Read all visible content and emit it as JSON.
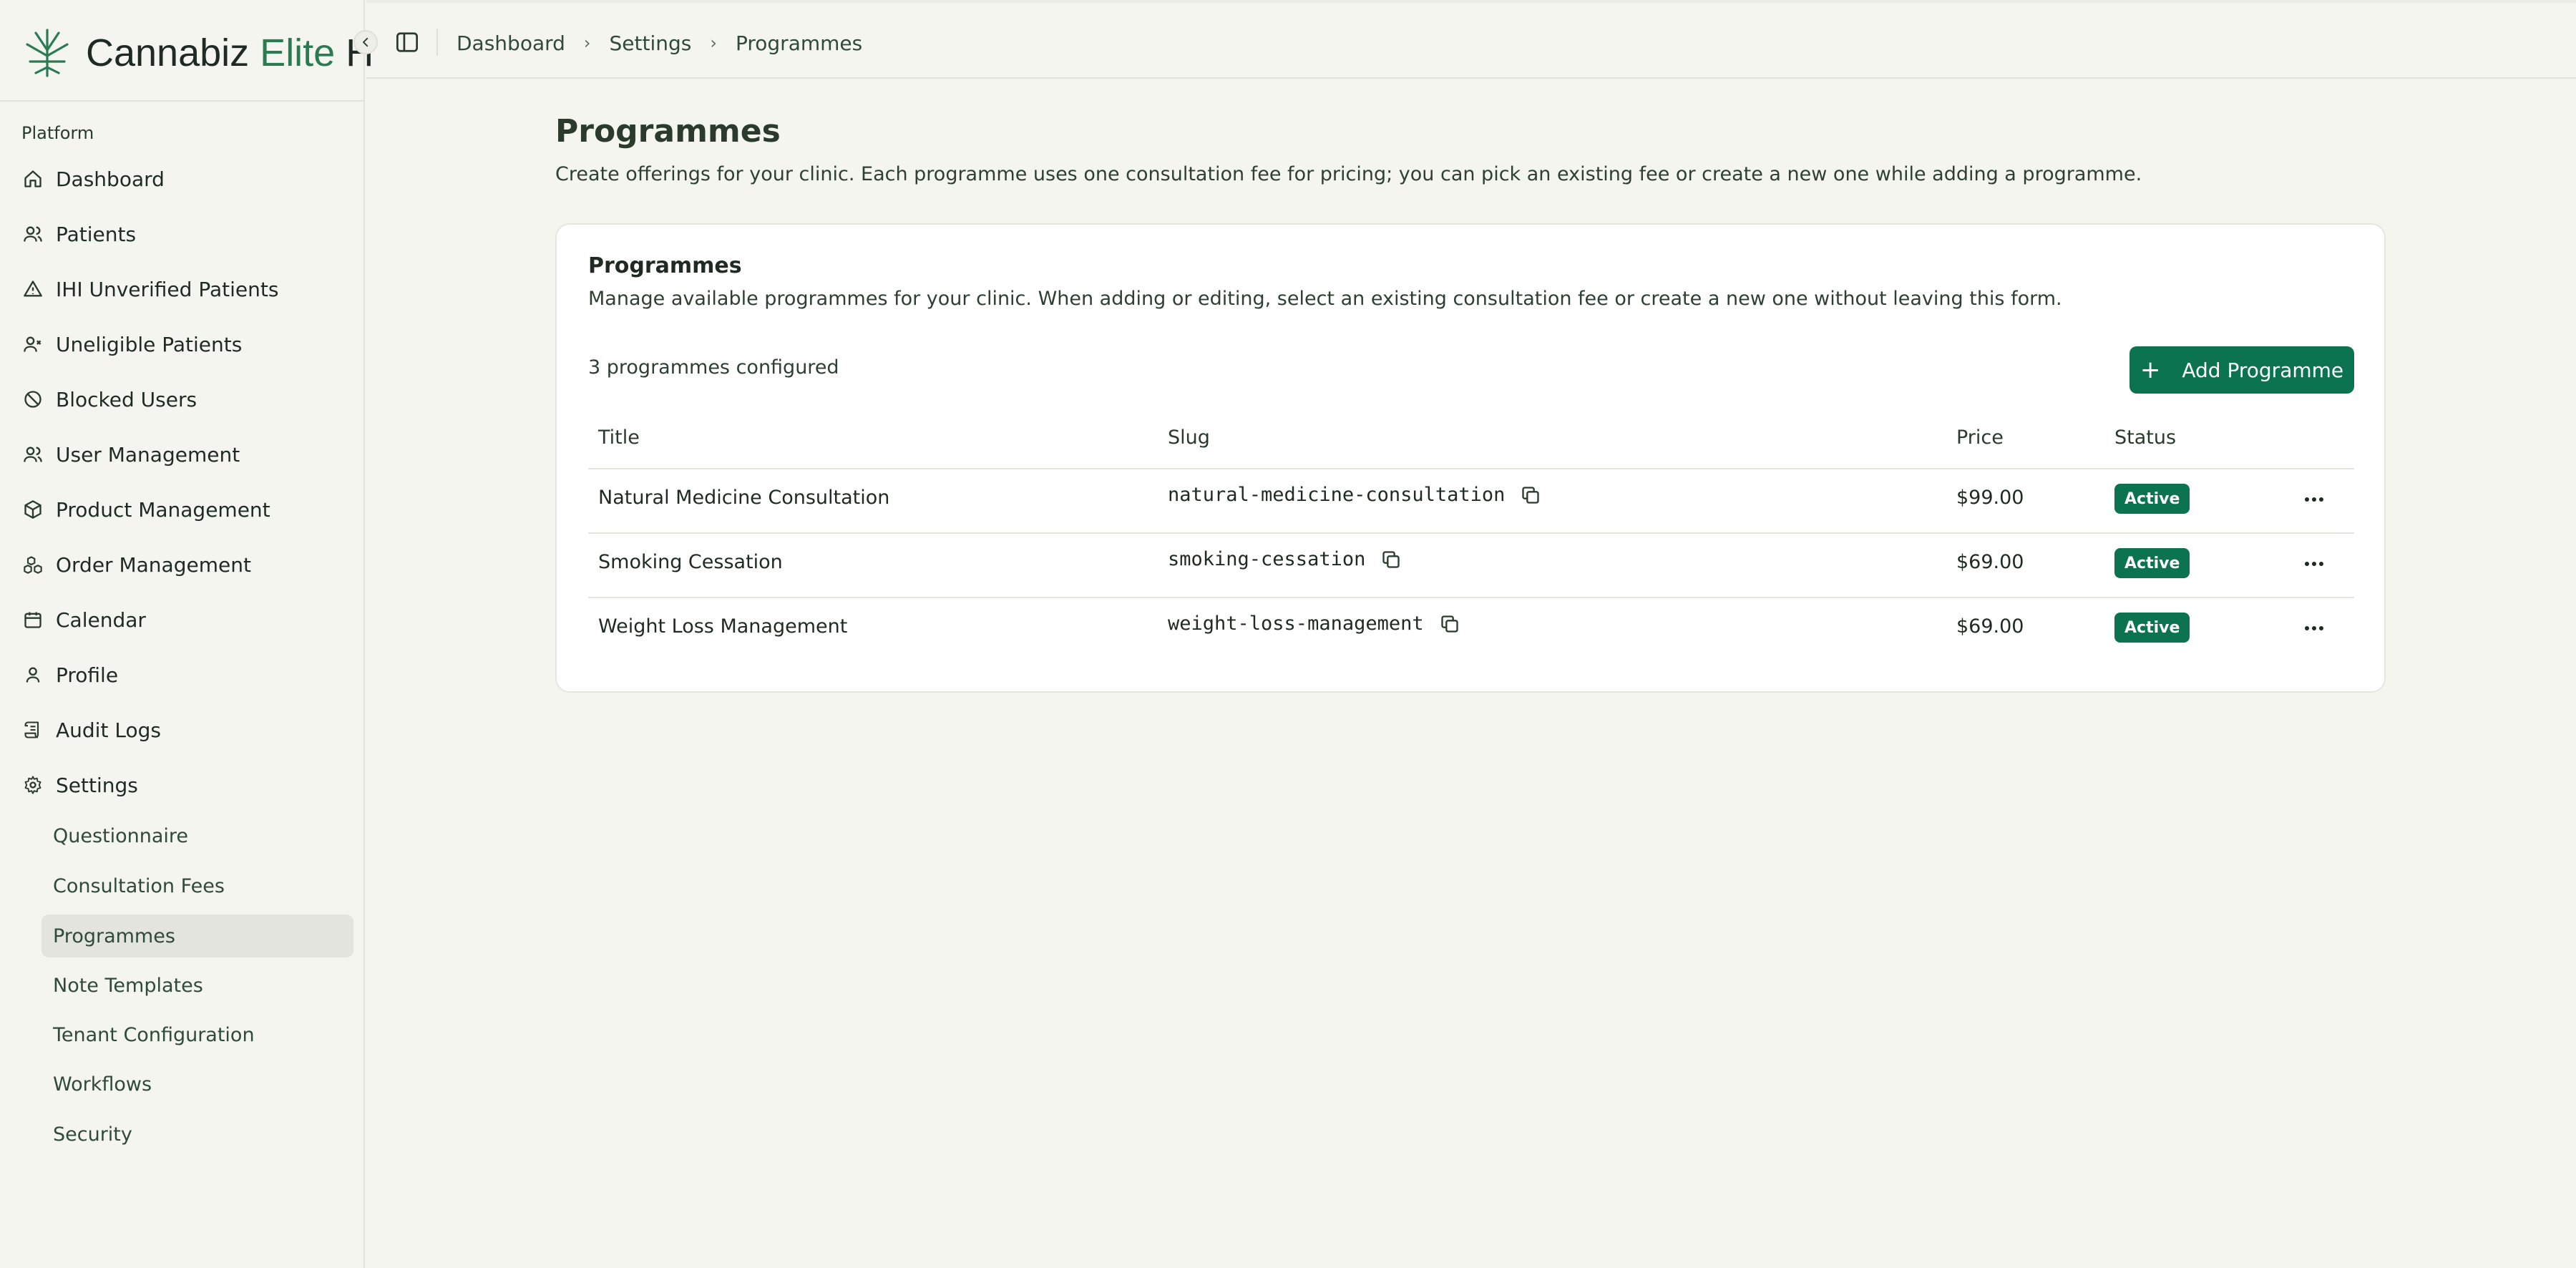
{
  "brand": {
    "name_main": "Cannabiz",
    "name_accent": "Elite",
    "name_truncated": "H"
  },
  "sidebar": {
    "section_label": "Platform",
    "items": [
      {
        "label": "Dashboard",
        "icon": "home-icon"
      },
      {
        "label": "Patients",
        "icon": "users-icon"
      },
      {
        "label": "IHI Unverified Patients",
        "icon": "warning-triangle-icon"
      },
      {
        "label": "Uneligible Patients",
        "icon": "user-x-icon"
      },
      {
        "label": "Blocked Users",
        "icon": "ban-icon"
      },
      {
        "label": "User Management",
        "icon": "users-icon"
      },
      {
        "label": "Product Management",
        "icon": "package-icon"
      },
      {
        "label": "Order Management",
        "icon": "boxes-icon"
      },
      {
        "label": "Calendar",
        "icon": "calendar-icon"
      },
      {
        "label": "Profile",
        "icon": "user-icon"
      },
      {
        "label": "Audit Logs",
        "icon": "scroll-icon"
      },
      {
        "label": "Settings",
        "icon": "gear-icon"
      }
    ],
    "settings_sub": [
      {
        "label": "Questionnaire",
        "active": false
      },
      {
        "label": "Consultation Fees",
        "active": false
      },
      {
        "label": "Programmes",
        "active": true
      },
      {
        "label": "Note Templates",
        "active": false
      },
      {
        "label": "Tenant Configuration",
        "active": false
      },
      {
        "label": "Workflows",
        "active": false
      },
      {
        "label": "Security",
        "active": false
      }
    ]
  },
  "breadcrumb": [
    "Dashboard",
    "Settings",
    "Programmes"
  ],
  "page": {
    "title": "Programmes",
    "description": "Create offerings for your clinic. Each programme uses one consultation fee for pricing; you can pick an existing fee or create a new one while adding a programme."
  },
  "card": {
    "title": "Programmes",
    "description": "Manage available programmes for your clinic. When adding or editing, select an existing consultation fee or create a new one without leaving this form.",
    "count_text": "3 programmes configured",
    "add_button": "Add Programme",
    "columns": [
      "Title",
      "Slug",
      "Price",
      "Status"
    ],
    "rows": [
      {
        "title": "Natural Medicine Consultation",
        "slug": "natural-medicine-consultation",
        "price": "$99.00",
        "status": "Active"
      },
      {
        "title": "Smoking Cessation",
        "slug": "smoking-cessation",
        "price": "$69.00",
        "status": "Active"
      },
      {
        "title": "Weight Loss Management",
        "slug": "weight-loss-management",
        "price": "$69.00",
        "status": "Active"
      }
    ]
  },
  "colors": {
    "accent": "#0c7350",
    "brand_accent": "#2a7a52",
    "background": "#f5f5f0"
  }
}
